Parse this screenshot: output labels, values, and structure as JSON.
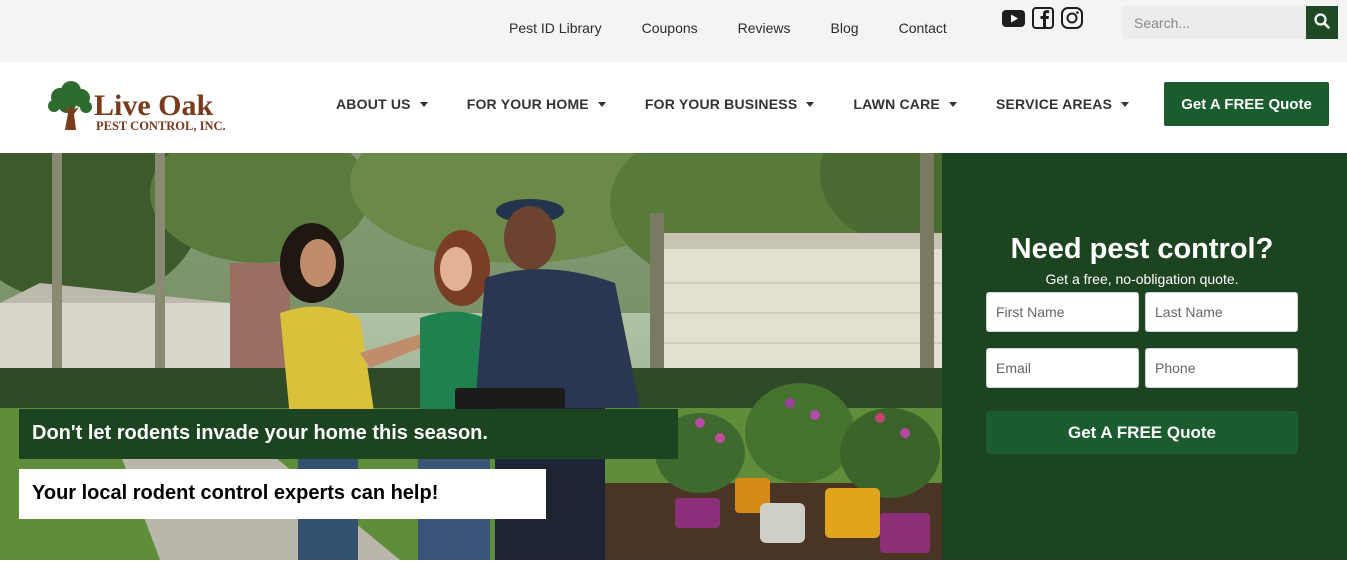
{
  "topbar": {
    "links": [
      "Pest ID Library",
      "Coupons",
      "Reviews",
      "Blog",
      "Contact"
    ],
    "social": [
      "youtube-icon",
      "facebook-icon",
      "instagram-icon"
    ],
    "search_placeholder": "Search..."
  },
  "brand": {
    "name_line1": "Live Oak",
    "name_line2": "PEST CONTROL, INC.",
    "colors": {
      "green": "#2e6b2f",
      "brown": "#7a3b1d",
      "dark_green": "#1d4421",
      "button_green": "#1a5c2d"
    }
  },
  "nav": {
    "items": [
      {
        "label": "ABOUT US"
      },
      {
        "label": "FOR YOUR HOME"
      },
      {
        "label": "FOR YOUR BUSINESS"
      },
      {
        "label": "LAWN CARE"
      },
      {
        "label": "SERVICE AREAS"
      }
    ],
    "cta_label": "Get A FREE Quote"
  },
  "hero": {
    "headline": "Don't let rodents invade your home this season.",
    "subline": "Your local rodent control experts can help!"
  },
  "form": {
    "title": "Need pest control?",
    "subtitle": "Get a free, no-obligation quote.",
    "first_name_placeholder": "First Name",
    "last_name_placeholder": "Last Name",
    "email_placeholder": "Email",
    "phone_placeholder": "Phone",
    "submit_label": "Get A FREE Quote"
  }
}
